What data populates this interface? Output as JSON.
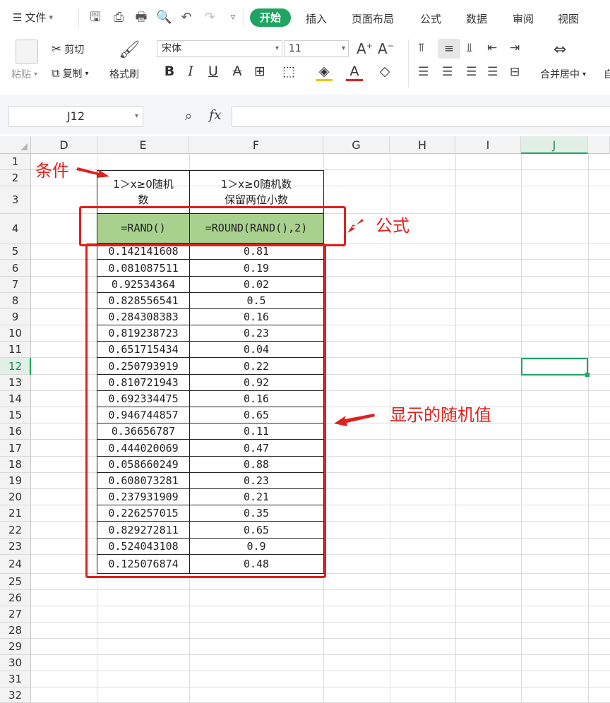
{
  "menu": {
    "file_label": "文件",
    "tabs": [
      "开始",
      "插入",
      "页面布局",
      "公式",
      "数据",
      "审阅",
      "视图"
    ]
  },
  "toolbar": {
    "paste_label": "粘贴",
    "cut_label": "剪切",
    "copy_label": "复制",
    "format_painter_label": "格式刷",
    "font_name": "宋体",
    "font_size": "11",
    "merge_label": "合并居中",
    "auto_label": "自"
  },
  "formula_bar": {
    "name_box": "J12",
    "fx_label": "fx",
    "formula": ""
  },
  "columns": [
    "D",
    "E",
    "F",
    "G",
    "H",
    "I",
    "J"
  ],
  "selected_column": "J",
  "selected_row": 12,
  "row_numbers": [
    1,
    2,
    3,
    4,
    5,
    6,
    7,
    8,
    9,
    10,
    11,
    12,
    13,
    14,
    15,
    16,
    17,
    18,
    19,
    20,
    21,
    22,
    23,
    24,
    25,
    26,
    27,
    28,
    29,
    30,
    31,
    32
  ],
  "table": {
    "header_e_line1": "1＞x≥0随机",
    "header_e_line2": "数",
    "header_f_line1": "1＞x≥0随机数",
    "header_f_line2": "保留两位小数",
    "formula_e": "=RAND()",
    "formula_f": "=ROUND(RAND(),2)",
    "rows": [
      {
        "e": "0.142141608",
        "f": "0.81"
      },
      {
        "e": "0.081087511",
        "f": "0.19"
      },
      {
        "e": "0.92534364",
        "f": "0.02"
      },
      {
        "e": "0.828556541",
        "f": "0.5"
      },
      {
        "e": "0.284308383",
        "f": "0.16"
      },
      {
        "e": "0.819238723",
        "f": "0.23"
      },
      {
        "e": "0.651715434",
        "f": "0.04"
      },
      {
        "e": "0.250793919",
        "f": "0.22"
      },
      {
        "e": "0.810721943",
        "f": "0.92"
      },
      {
        "e": "0.692334475",
        "f": "0.16"
      },
      {
        "e": "0.946744857",
        "f": "0.65"
      },
      {
        "e": "0.36656787",
        "f": "0.11"
      },
      {
        "e": "0.444020069",
        "f": "0.47"
      },
      {
        "e": "0.058660249",
        "f": "0.88"
      },
      {
        "e": "0.608073281",
        "f": "0.23"
      },
      {
        "e": "0.237931909",
        "f": "0.21"
      },
      {
        "e": "0.226257015",
        "f": "0.35"
      },
      {
        "e": "0.829272811",
        "f": "0.65"
      },
      {
        "e": "0.524043108",
        "f": "0.9"
      },
      {
        "e": "0.125076874",
        "f": "0.48"
      }
    ]
  },
  "annotations": {
    "condition": "条件",
    "formula": "公式",
    "display": "显示的随机值"
  },
  "colors": {
    "accent": "#1fa463",
    "annotation_red": "#e0201b",
    "formula_fill": "#a9d18e"
  }
}
